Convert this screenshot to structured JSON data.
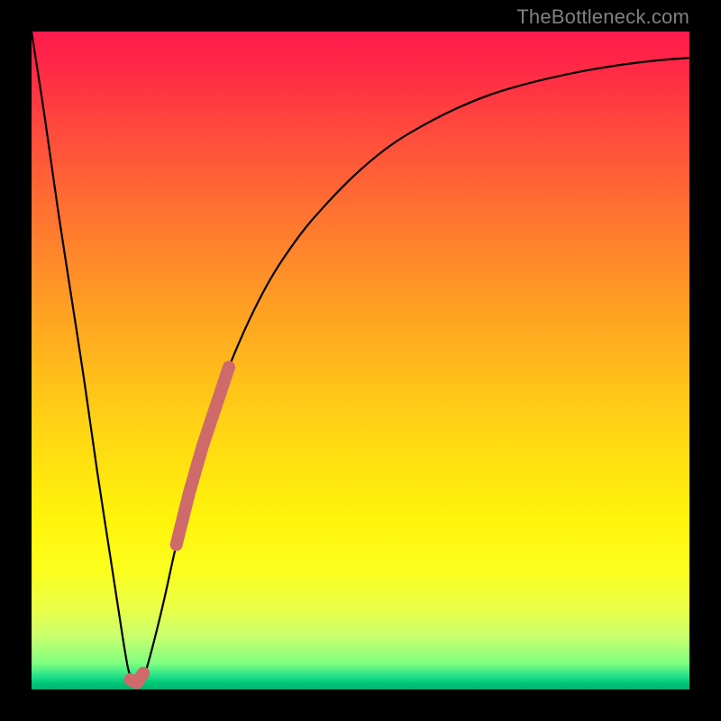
{
  "watermark": "TheBottleneck.com",
  "chart_data": {
    "type": "line",
    "title": "",
    "xlabel": "",
    "ylabel": "",
    "xlim": [
      0,
      100
    ],
    "ylim": [
      0,
      100
    ],
    "grid": false,
    "legend": false,
    "description": "Bottleneck deviation curve on vertical red→green gradient; black V-shaped curve with minimum near x≈15, salmon marker segment along ascending branch and at minimum.",
    "series": [
      {
        "name": "deviation-curve",
        "color": "#000000",
        "x": [
          0,
          2,
          4,
          6,
          8,
          10,
          12,
          14,
          15,
          16,
          17,
          18,
          20,
          22,
          24,
          27,
          30,
          35,
          40,
          45,
          50,
          55,
          60,
          65,
          70,
          75,
          80,
          85,
          90,
          95,
          100
        ],
        "y": [
          100,
          87,
          73,
          60,
          47,
          33,
          20,
          7,
          2,
          1,
          2,
          5,
          13,
          22,
          30,
          40,
          49,
          60,
          68,
          74,
          79,
          83,
          86,
          88.5,
          90.5,
          92,
          93.2,
          94.2,
          95,
          95.6,
          96
        ]
      },
      {
        "name": "marker-ascending",
        "color": "#d06060",
        "x": [
          22,
          23,
          24,
          25,
          26,
          27,
          28,
          29,
          30
        ],
        "y": [
          22,
          26,
          30,
          33.5,
          37,
          40,
          43,
          46,
          49
        ]
      },
      {
        "name": "marker-minimum",
        "color": "#d06060",
        "x": [
          15,
          16,
          17
        ],
        "y": [
          1.5,
          1,
          2.5
        ]
      }
    ],
    "background_gradient": {
      "orientation": "vertical",
      "stops": [
        {
          "pos": 0.0,
          "color": "#ff1a4d"
        },
        {
          "pos": 0.15,
          "color": "#ff4a3d"
        },
        {
          "pos": 0.35,
          "color": "#ff8a2a"
        },
        {
          "pos": 0.55,
          "color": "#ffc618"
        },
        {
          "pos": 0.74,
          "color": "#fff40a"
        },
        {
          "pos": 0.88,
          "color": "#e8ff4a"
        },
        {
          "pos": 0.96,
          "color": "#80ff80"
        },
        {
          "pos": 1.0,
          "color": "#00b070"
        }
      ]
    }
  }
}
